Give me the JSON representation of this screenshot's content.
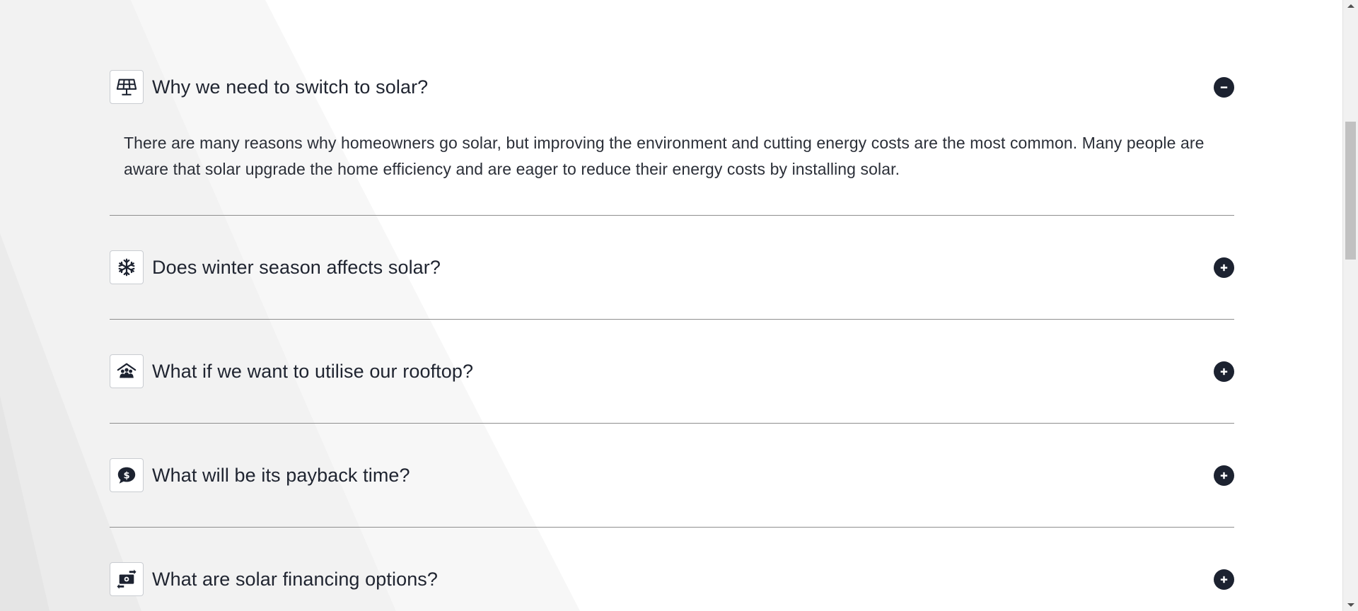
{
  "faq": {
    "items": [
      {
        "question": "Why we need to switch to solar?",
        "icon": "solar-panel-icon",
        "expanded": true,
        "answer": "There are many reasons why homeowners go solar, but improving the environment and cutting energy costs are the most common. Many people are aware that solar upgrade the home efficiency and are eager to reduce their energy costs by installing solar."
      },
      {
        "question": "Does winter season affects solar?",
        "icon": "snowflake-icon",
        "expanded": false
      },
      {
        "question": "What if we want to utilise our rooftop?",
        "icon": "house-people-icon",
        "expanded": false
      },
      {
        "question": "What will be its payback time?",
        "icon": "dollar-speech-bubble-icon",
        "expanded": false
      },
      {
        "question": "What are solar financing options?",
        "icon": "money-exchange-icon",
        "expanded": false
      }
    ]
  },
  "colors": {
    "text": "#1f2430",
    "toggle": "#1c2230",
    "divider": "#8e8e8e",
    "background": "#ffffff"
  }
}
